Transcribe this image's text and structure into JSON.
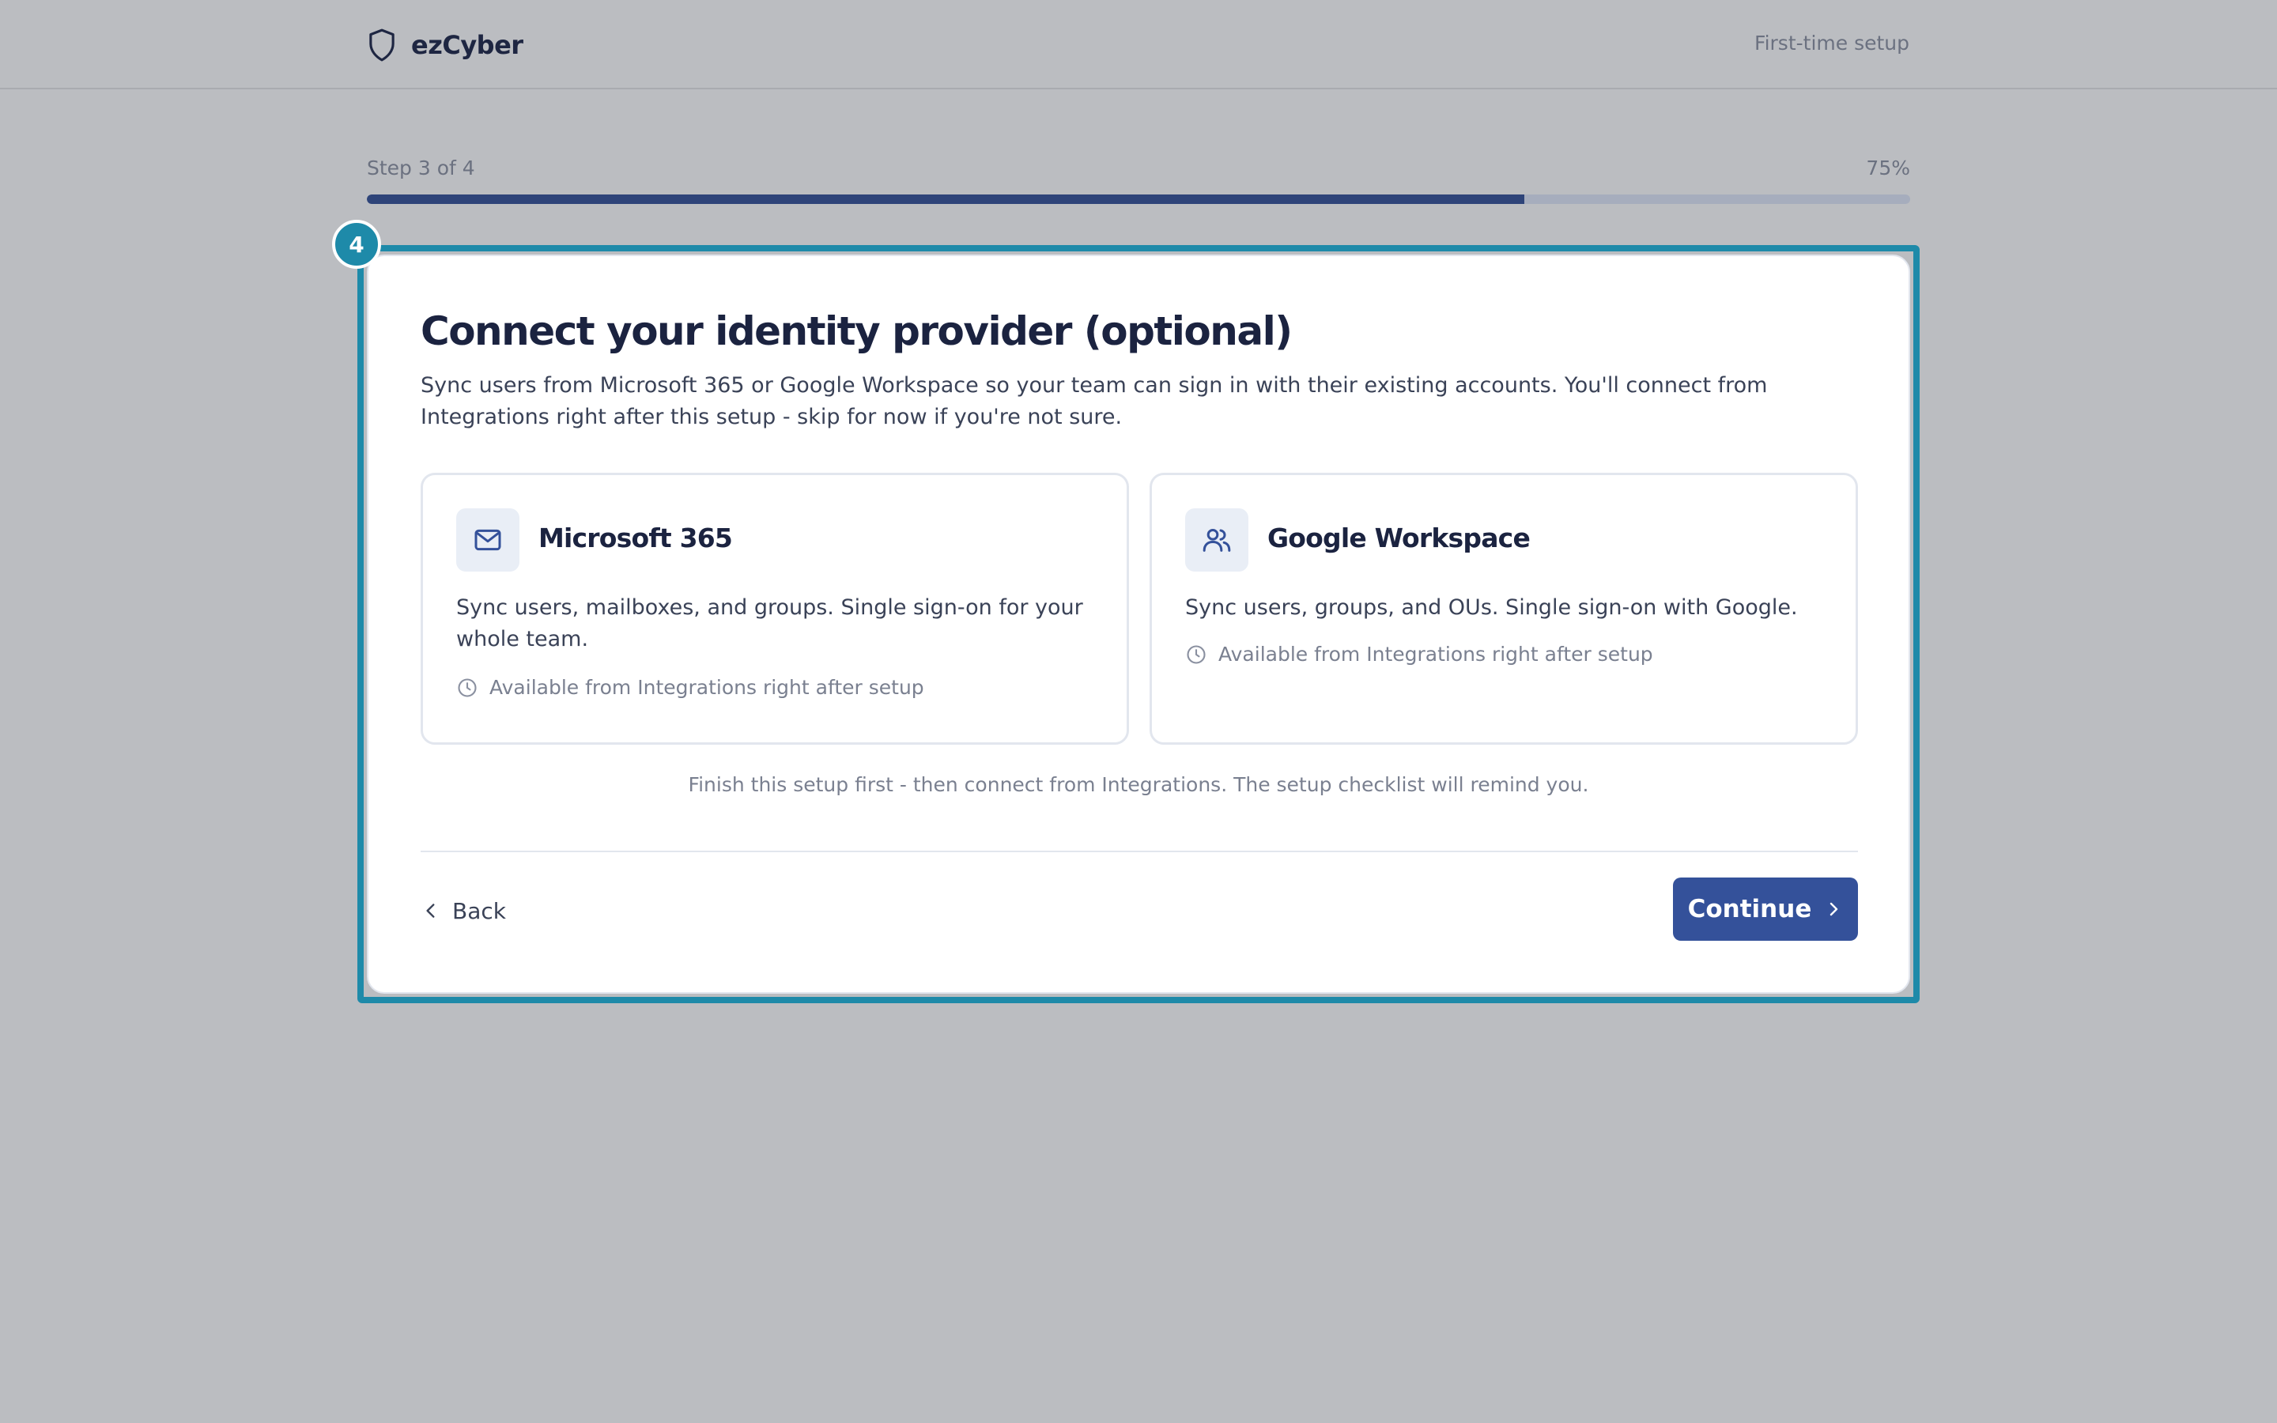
{
  "header": {
    "brand_name": "ezCyber",
    "setup_label": "First-time setup"
  },
  "progress": {
    "step_label": "Step 3 of 4",
    "percent_label": "75%",
    "value": 0.75
  },
  "overlay": {
    "badge_number": "4"
  },
  "card": {
    "title": "Connect your identity provider (optional)",
    "description": "Sync users from Microsoft 365 or Google Workspace so your team can sign in with their existing accounts. You'll connect from Integrations right after this setup - skip for now if you're not sure.",
    "providers": [
      {
        "name": "Microsoft 365",
        "icon": "mail-icon",
        "description": "Sync users, mailboxes, and groups. Single sign-on for your whole team.",
        "availability": "Available from Integrations right after setup"
      },
      {
        "name": "Google Workspace",
        "icon": "users-icon",
        "description": "Sync users, groups, and OUs. Single sign-on with Google.",
        "availability": "Available from Integrations right after setup"
      }
    ],
    "finish_note": "Finish this setup first - then connect from Integrations. The setup checklist will remind you.",
    "back_label": "Back",
    "continue_label": "Continue"
  },
  "colors": {
    "accent": "#34519a",
    "highlight": "#1e8aa9",
    "progress_fill": "#2e4479"
  }
}
